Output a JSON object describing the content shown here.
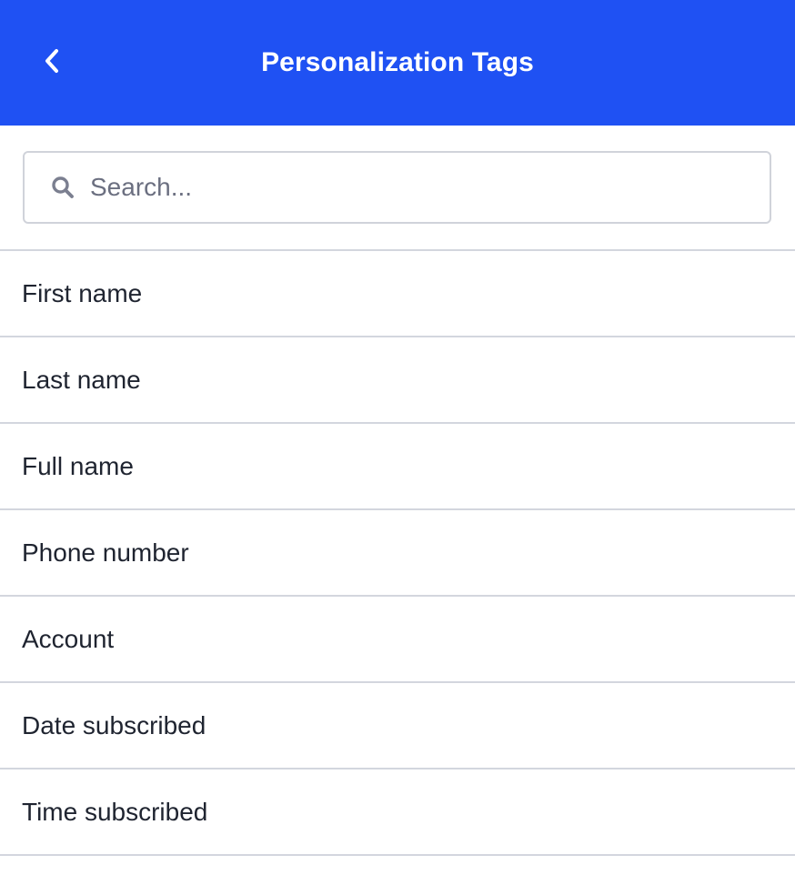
{
  "header": {
    "title": "Personalization Tags",
    "back_icon": "chevron-left-icon",
    "background_color": "#1f51f3"
  },
  "search": {
    "icon": "search-icon",
    "placeholder": "Search...",
    "value": ""
  },
  "tags": [
    {
      "label": "First name"
    },
    {
      "label": "Last name"
    },
    {
      "label": "Full name"
    },
    {
      "label": "Phone number"
    },
    {
      "label": "Account"
    },
    {
      "label": "Date subscribed"
    },
    {
      "label": "Time subscribed"
    }
  ]
}
